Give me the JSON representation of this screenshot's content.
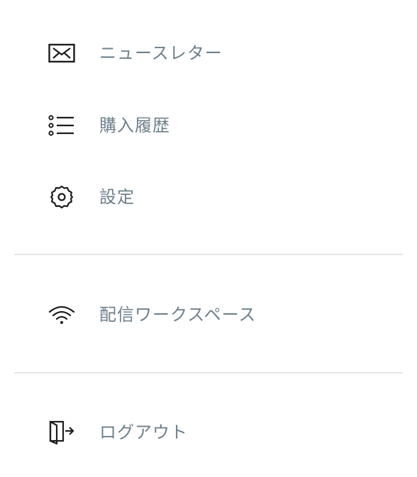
{
  "menu": {
    "newsletter": {
      "label": "ニュースレター",
      "icon": "mail-icon"
    },
    "purchase_history": {
      "label": "購入履歴",
      "icon": "list-icon"
    },
    "settings": {
      "label": "設定",
      "icon": "gear-icon"
    },
    "workspace": {
      "label": "配信ワークスペース",
      "icon": "wifi-icon"
    },
    "logout": {
      "label": "ログアウト",
      "icon": "logout-door-icon"
    }
  },
  "colors": {
    "label": "#6d808c",
    "icon": "#1c1c1c",
    "divider": "#e3e6e8",
    "background": "#ffffff"
  }
}
